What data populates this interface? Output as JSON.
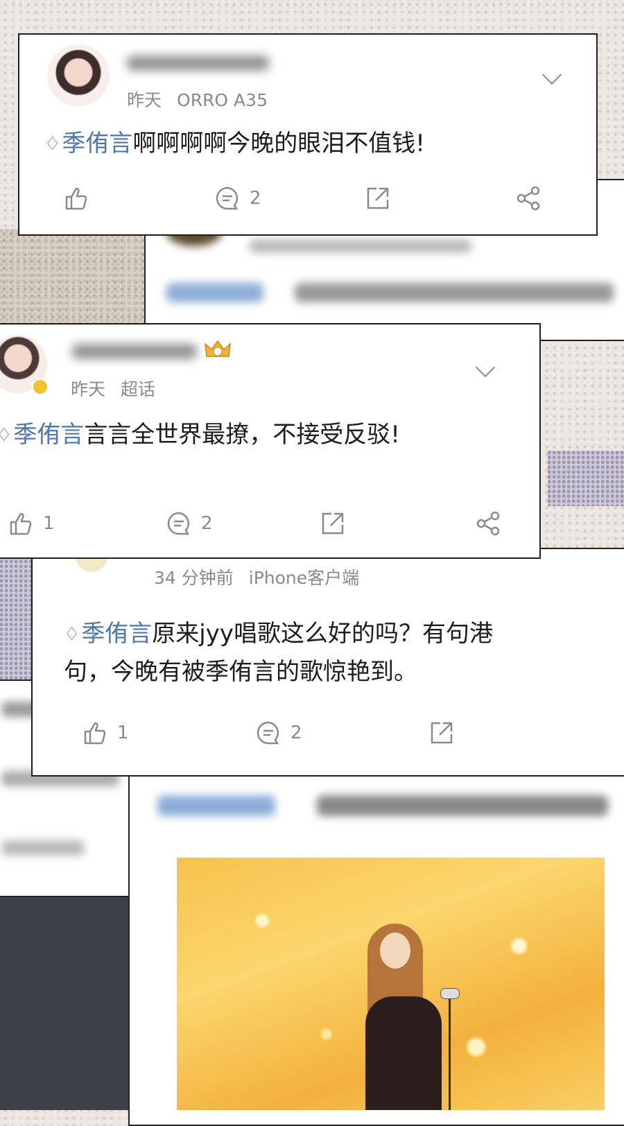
{
  "cards": [
    {
      "time": "昨天",
      "source": "ORRO A35",
      "tag": "季侑言",
      "text": "啊啊啊啊今晚的眼泪不值钱!",
      "likes": "",
      "comments": "2"
    },
    {
      "time": "昨天",
      "source": "超话",
      "tag": "季侑言",
      "text": "言言全世界最撩，不接受反驳!",
      "likes": "1",
      "comments": "2"
    },
    {
      "time": "34 分钟前",
      "source": "iPhone客户端",
      "tag": "季侑言",
      "text_line1": "原来jyy唱歌这么好的吗？有句港",
      "text_line2": "句，今晚有被季侑言的歌惊艳到。",
      "likes": "1",
      "comments": "2"
    }
  ],
  "icons": {
    "tag": "diamond-icon",
    "like": "thumbs-up-icon",
    "comment": "comment-icon",
    "repost": "share-out-icon",
    "share": "share-icon",
    "menu": "chevron-down-icon"
  },
  "colors": {
    "tag": "#4d78ad",
    "meta": "#8a8a8a",
    "text": "#1c1c1c"
  }
}
